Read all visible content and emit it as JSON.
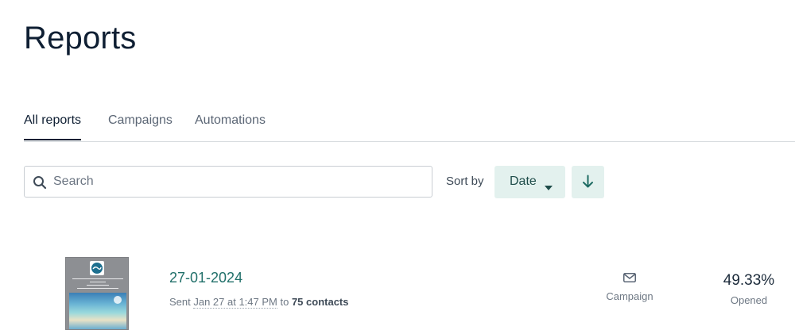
{
  "page": {
    "title": "Reports"
  },
  "tabs": [
    {
      "label": "All reports",
      "active": true
    },
    {
      "label": "Campaigns",
      "active": false
    },
    {
      "label": "Automations",
      "active": false
    }
  ],
  "search": {
    "placeholder": "Search",
    "value": "",
    "icon": "search-icon"
  },
  "sort": {
    "label": "Sort by",
    "selected": "Date",
    "direction_icon": "arrow-down-icon"
  },
  "reports": [
    {
      "title": "27-01-2024",
      "meta": {
        "prefix": "Sent ",
        "date": "Jan 27 at 1:47 PM",
        "middle": " to ",
        "contacts": "75 contacts"
      },
      "type_icon": "envelope-icon",
      "type_label": "Campaign",
      "stat_value": "49.33%",
      "stat_label": "Opened"
    }
  ],
  "colors": {
    "accent": "#21706a",
    "button_bg": "#e3f1ee",
    "text_dark": "#0f1f33"
  }
}
